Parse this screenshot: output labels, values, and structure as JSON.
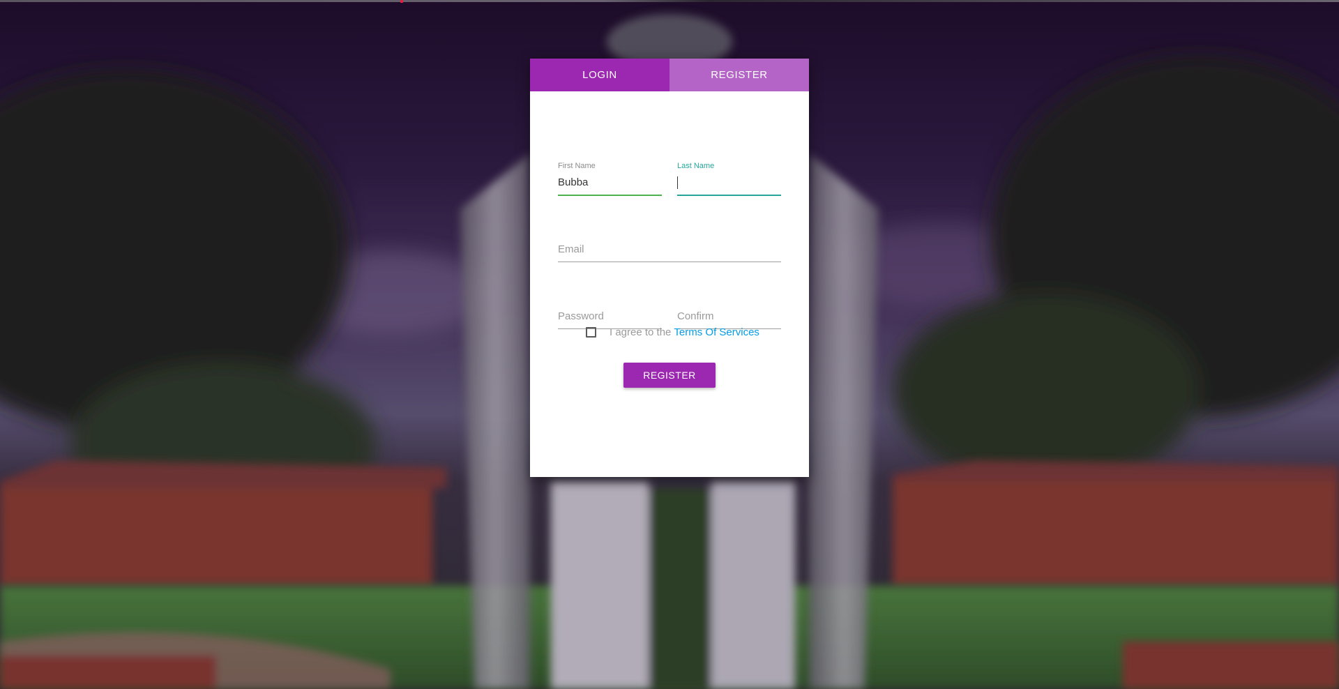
{
  "tabs": {
    "login_label": "LOGIN",
    "register_label": "REGISTER"
  },
  "form": {
    "first_name": {
      "label": "First Name",
      "value": "Bubba"
    },
    "last_name": {
      "label": "Last Name",
      "value": ""
    },
    "email": {
      "placeholder": "Email",
      "value": ""
    },
    "password": {
      "placeholder": "Password",
      "value": ""
    },
    "confirm": {
      "placeholder": "Confirm",
      "value": ""
    },
    "agree": {
      "text": "I agree to the",
      "link_text": "Terms Of Services",
      "checked": false
    },
    "submit_label": "REGISTER"
  },
  "colors": {
    "primary": "#9c27b0",
    "tab_inactive": "#b464c6",
    "valid_underline": "#4caf50",
    "focus_underline": "#26a69a",
    "link": "#039be5"
  }
}
